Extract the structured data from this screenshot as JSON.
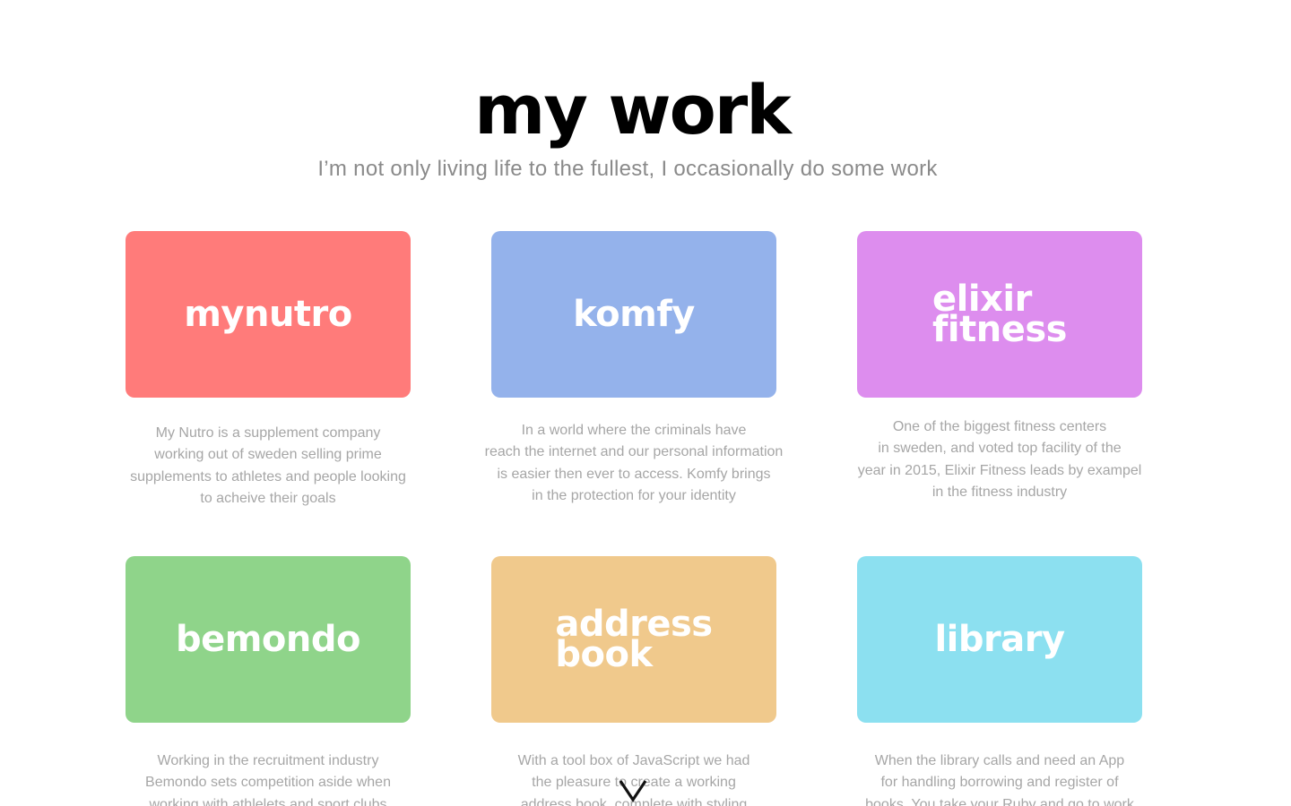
{
  "header": {
    "title": "my work",
    "subtitle": "I’m not only living life to the fullest, I occasionally do some work"
  },
  "projects": [
    {
      "title_lines": [
        "mynutro"
      ],
      "color": "#ff7b7a",
      "description_lines": [
        "My Nutro is a supplement company",
        "working out of sweden selling prime",
        "supplements to athletes and people looking",
        "to acheive their goals"
      ]
    },
    {
      "title_lines": [
        "komfy"
      ],
      "color": "#94b2eb",
      "description_lines": [
        "In a world where the criminals have",
        "reach the internet and our personal information",
        "is easier then ever to access. Komfy brings",
        "in the protection for your identity"
      ]
    },
    {
      "title_lines": [
        "elixir",
        "fitness"
      ],
      "color": "#dd8dee",
      "description_lines": [
        "One of the biggest fitness centers",
        "in sweden, and voted top facility of the",
        "year in 2015, Elixir Fitness leads by exampel",
        "in the fitness industry"
      ]
    },
    {
      "title_lines": [
        "bemondo"
      ],
      "color": "#8fd48a",
      "description_lines": [
        "Working in the recruitment industry",
        "Bemondo sets competition aside when",
        "working with athlelets and sport clubs"
      ]
    },
    {
      "title_lines": [
        "address",
        "book"
      ],
      "color": "#f0c98c",
      "description_lines": [
        "With a tool box of JavaScript we had",
        "the pleasure to create a working",
        "address book, complete with styling"
      ]
    },
    {
      "title_lines": [
        "library"
      ],
      "color": "#8ce0f0",
      "description_lines": [
        "When the library calls and need an App",
        "for handling borrowing and register of",
        "books. You take your Ruby and go to work"
      ]
    }
  ],
  "scroll_indicator": {
    "icon": "chevron-down-icon"
  }
}
